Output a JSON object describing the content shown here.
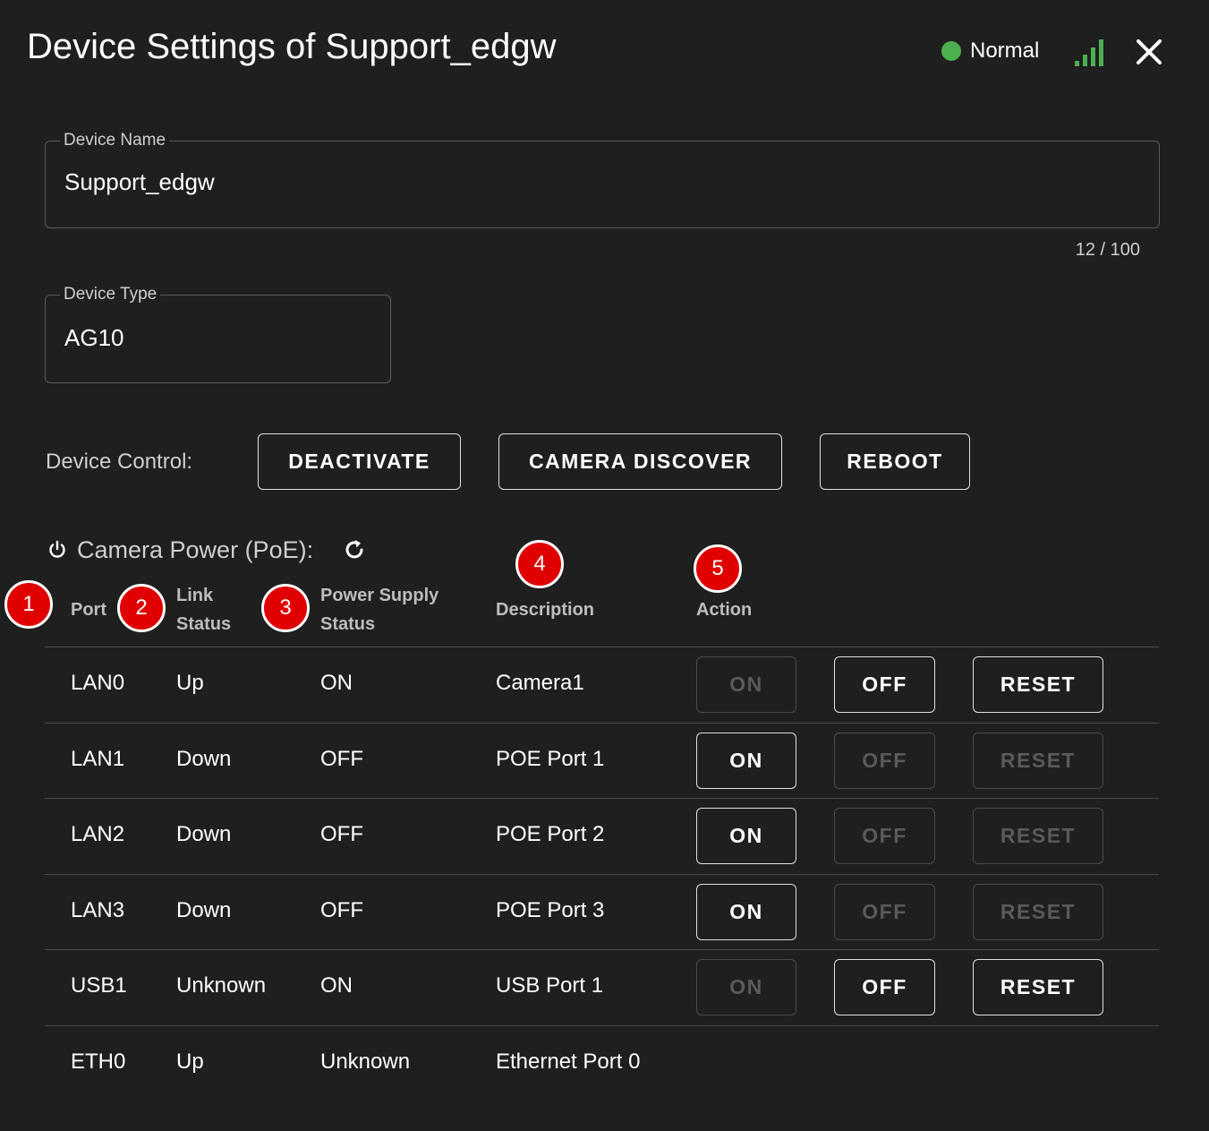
{
  "header": {
    "title": "Device Settings of Support_edgw",
    "status_text": "Normal",
    "colors": {
      "status_dot": "#4caf50",
      "signal": "#4caf50"
    },
    "icons": [
      "status-dot-icon",
      "signal-icon",
      "close-icon"
    ]
  },
  "device_name": {
    "label": "Device Name",
    "value": "Support_edgw",
    "counter": "12 / 100"
  },
  "device_type": {
    "label": "Device Type",
    "value": "AG10"
  },
  "device_control": {
    "label": "Device Control:",
    "buttons": [
      "DEACTIVATE",
      "CAMERA DISCOVER",
      "REBOOT"
    ]
  },
  "poe": {
    "title": "Camera Power (PoE):",
    "icons": [
      "power-icon",
      "refresh-icon"
    ],
    "headers": {
      "port": "Port",
      "link_line1": "Link",
      "link_line2": "Status",
      "power_line1": "Power Supply",
      "power_line2": "Status",
      "description": "Description",
      "action": "Action"
    },
    "badges": [
      "1",
      "2",
      "3",
      "4",
      "5"
    ],
    "rows": [
      {
        "port": "LAN0",
        "link": "Up",
        "power": "ON",
        "description": "Camera1",
        "actions": [
          {
            "label": "ON",
            "enabled": false
          },
          {
            "label": "OFF",
            "enabled": true
          },
          {
            "label": "RESET",
            "enabled": true
          }
        ]
      },
      {
        "port": "LAN1",
        "link": "Down",
        "power": "OFF",
        "description": "POE Port 1",
        "actions": [
          {
            "label": "ON",
            "enabled": true
          },
          {
            "label": "OFF",
            "enabled": false
          },
          {
            "label": "RESET",
            "enabled": false
          }
        ]
      },
      {
        "port": "LAN2",
        "link": "Down",
        "power": "OFF",
        "description": "POE Port 2",
        "actions": [
          {
            "label": "ON",
            "enabled": true
          },
          {
            "label": "OFF",
            "enabled": false
          },
          {
            "label": "RESET",
            "enabled": false
          }
        ]
      },
      {
        "port": "LAN3",
        "link": "Down",
        "power": "OFF",
        "description": "POE Port 3",
        "actions": [
          {
            "label": "ON",
            "enabled": true
          },
          {
            "label": "OFF",
            "enabled": false
          },
          {
            "label": "RESET",
            "enabled": false
          }
        ]
      },
      {
        "port": "USB1",
        "link": "Unknown",
        "power": "ON",
        "description": "USB Port 1",
        "actions": [
          {
            "label": "ON",
            "enabled": false
          },
          {
            "label": "OFF",
            "enabled": true
          },
          {
            "label": "RESET",
            "enabled": true
          }
        ]
      },
      {
        "port": "ETH0",
        "link": "Up",
        "power": "Unknown",
        "description": "Ethernet Port 0",
        "actions": []
      }
    ]
  }
}
